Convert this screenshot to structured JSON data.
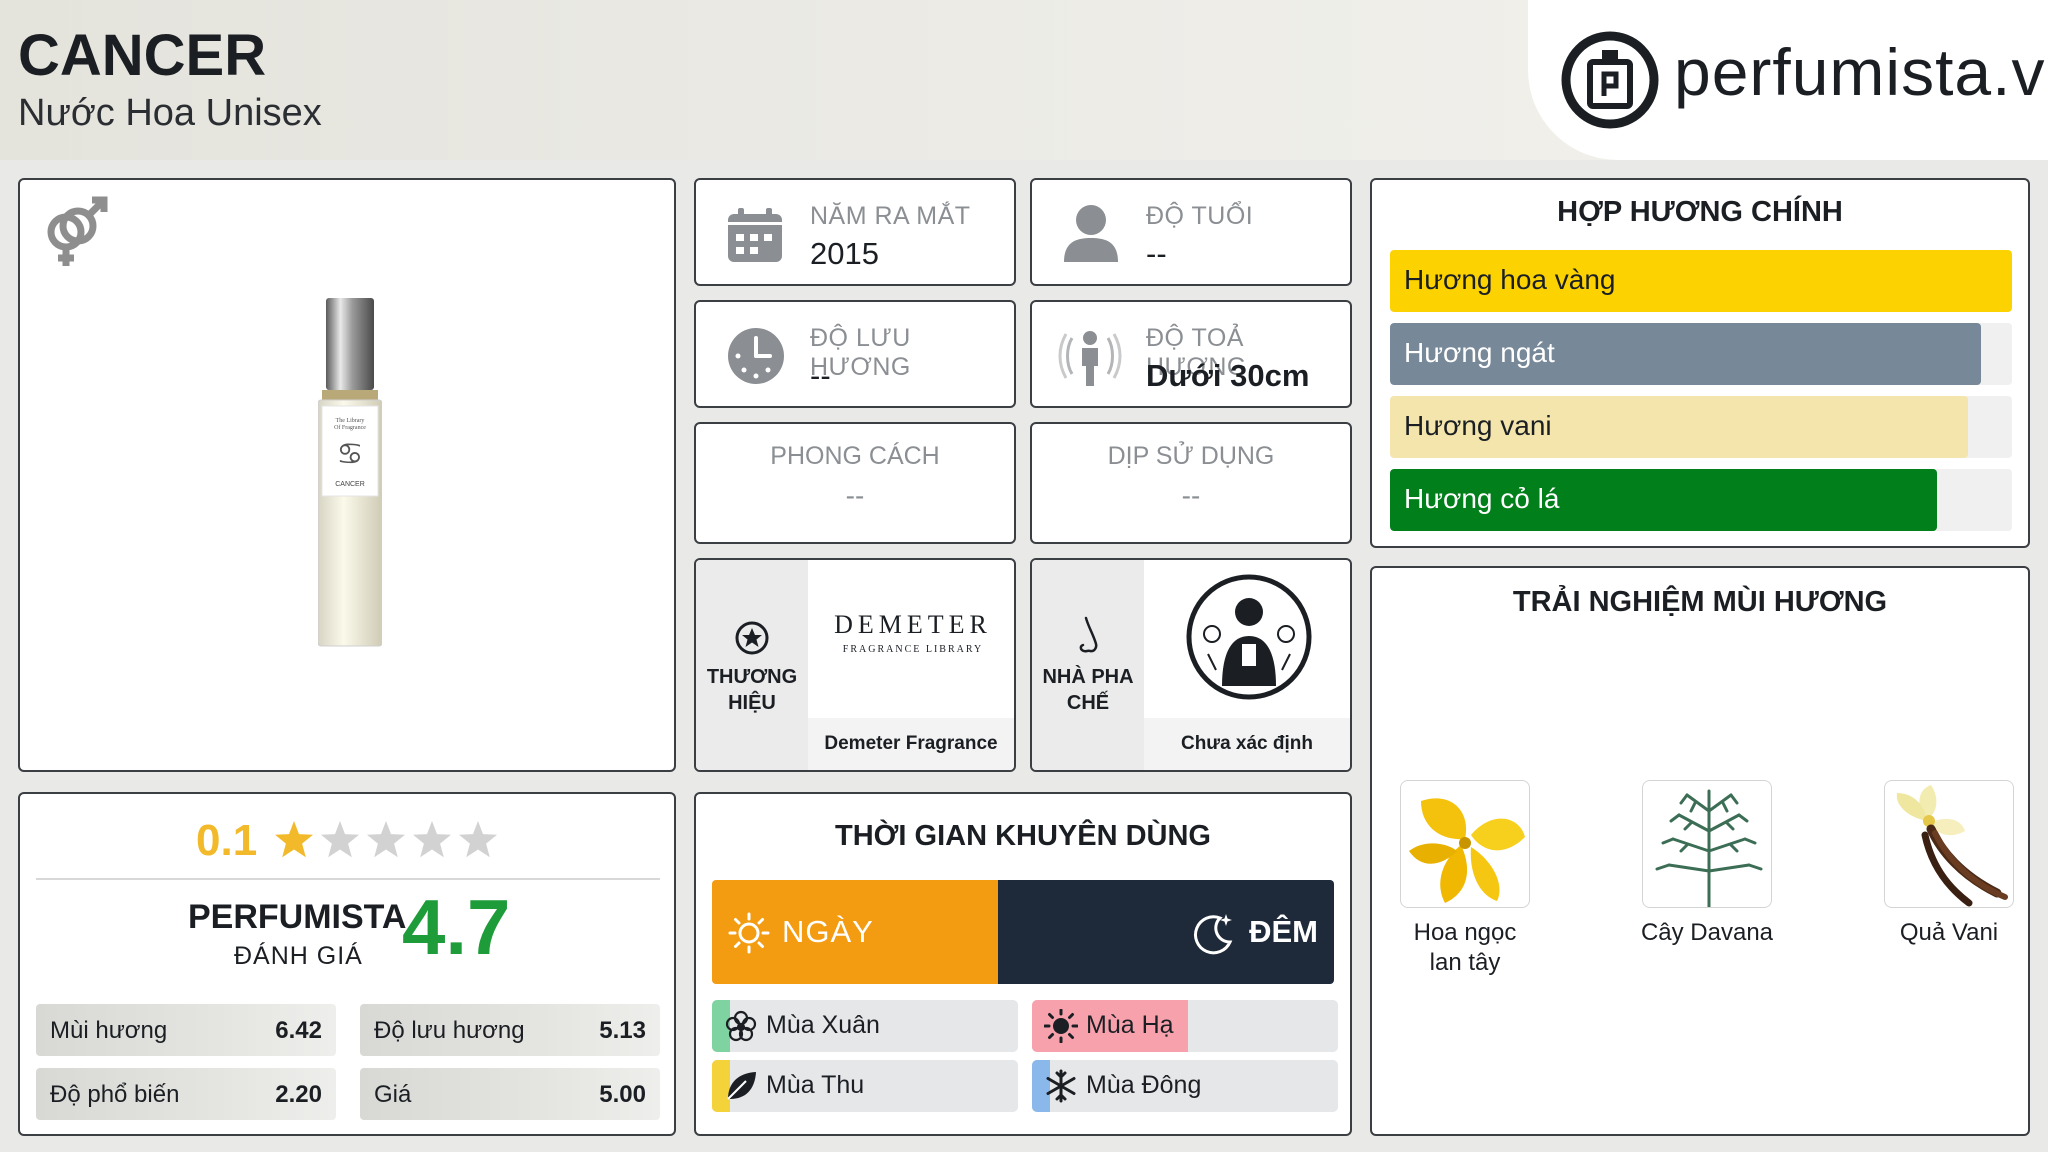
{
  "header": {
    "title": "CANCER",
    "subtitle": "Nước Hoa Unisex",
    "logo_text": "perfumista.vn"
  },
  "product": {
    "gender_icon": "unisex-gender-icon",
    "bottle_label": "CANCER",
    "bottle_brand": "The Library Of Fragrance"
  },
  "info": {
    "release_label": "NĂM RA MẮT",
    "release_value": "2015",
    "age_label": "ĐỘ TUỔI",
    "age_value": "--",
    "longevity_label": "ĐỘ LƯU HƯƠNG",
    "longevity_value": "--",
    "sillage_label": "ĐỘ TOẢ HƯƠNG",
    "sillage_value": "Dưới 30cm",
    "style_label": "PHONG CÁCH",
    "style_value": "--",
    "occasion_label": "DỊP SỬ DỤNG",
    "occasion_value": "--"
  },
  "brand": {
    "side_label_1": "THƯƠNG",
    "side_label_2": "HIỆU",
    "logo_text": "DEMETER",
    "logo_sub": "FRAGRANCE LIBRARY",
    "name": "Demeter Fragrance"
  },
  "perfumer": {
    "side_label_1": "NHÀ PHA",
    "side_label_2": "CHẾ",
    "name": "Chưa xác định"
  },
  "accords": {
    "title": "HỢP HƯƠNG CHÍNH",
    "items": [
      {
        "label": "Hương hoa vàng",
        "percent": 100,
        "color": "#fcd200",
        "text_color": "#1b1f24"
      },
      {
        "label": "Hương ngát",
        "percent": 95,
        "color": "#778899",
        "text_color": "#ffffff"
      },
      {
        "label": "Hương vani",
        "percent": 93,
        "color": "#f3e5ab",
        "text_color": "#1b1f24"
      },
      {
        "label": "Hương cỏ lá",
        "percent": 88,
        "color": "#007f1a",
        "text_color": "#ffffff"
      }
    ]
  },
  "notes": {
    "title": "TRẢI NGHIỆM MÙI HƯƠNG",
    "items": [
      {
        "line1": "Hoa ngọc",
        "line2": "lan tây",
        "icon": "ylang-ylang-image"
      },
      {
        "line1": "Cây Davana",
        "line2": "",
        "icon": "davana-image"
      },
      {
        "line1": "Quả Vani",
        "line2": "",
        "icon": "vanilla-image"
      }
    ]
  },
  "rating": {
    "user_score": "0.1",
    "user_stars": 0.1,
    "perfumista_title": "PERFUMISTA",
    "perfumista_sub": "ĐÁNH GIÁ",
    "perfumista_score": "4.7",
    "metrics": [
      {
        "label": "Mùi hương",
        "value": "6.42"
      },
      {
        "label": "Độ lưu hương",
        "value": "5.13"
      },
      {
        "label": "Độ phổ biến",
        "value": "2.20"
      },
      {
        "label": "Giá",
        "value": "5.00"
      }
    ]
  },
  "time": {
    "title": "THỜI GIAN KHUYÊN DÙNG",
    "day_label": "NGÀY",
    "night_label": "ĐÊM",
    "day_fraction": 0.46,
    "day_color": "#f39c12",
    "night_color": "#1e2a3a",
    "seasons": [
      {
        "label": "Mùa Xuân",
        "fraction": 0.06,
        "color": "#7fd3a0",
        "icon": "spring-flower-icon"
      },
      {
        "label": "Mùa Hạ",
        "fraction": 0.51,
        "color": "#f6a1ab",
        "icon": "summer-sun-icon"
      },
      {
        "label": "Mùa Thu",
        "fraction": 0.06,
        "color": "#f3d23a",
        "icon": "autumn-leaf-icon"
      },
      {
        "label": "Mùa Đông",
        "fraction": 0.06,
        "color": "#8ab8ea",
        "icon": "winter-snowflake-icon"
      }
    ]
  }
}
